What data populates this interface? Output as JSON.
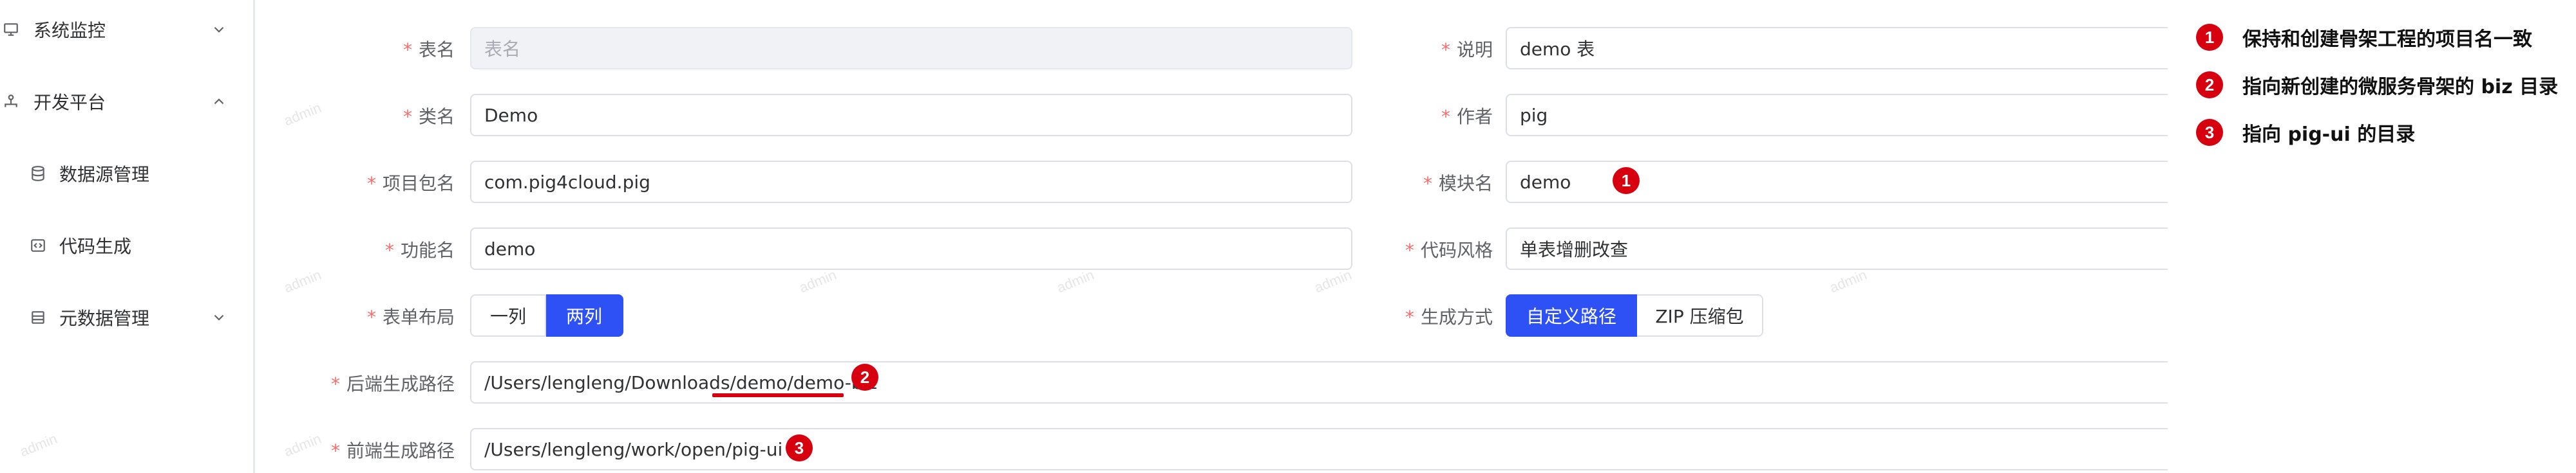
{
  "sidebar": {
    "items": [
      {
        "label": "系统监控",
        "icon": "monitor-icon",
        "chevron": "chevron-down-icon"
      },
      {
        "label": "开发平台",
        "icon": "platform-icon",
        "chevron": "chevron-up-icon"
      },
      {
        "label": "数据源管理",
        "icon": "database-icon"
      },
      {
        "label": "代码生成",
        "icon": "code-icon"
      },
      {
        "label": "元数据管理",
        "icon": "table-icon",
        "chevron": "chevron-down-icon"
      }
    ]
  },
  "watermark": "admin",
  "form": {
    "table_name": {
      "label": "表名",
      "placeholder": "表名"
    },
    "description": {
      "label": "说明",
      "value": "demo 表"
    },
    "class_name": {
      "label": "类名",
      "value": "Demo"
    },
    "author": {
      "label": "作者",
      "value": "pig"
    },
    "package_name": {
      "label": "项目包名",
      "value": "com.pig4cloud.pig"
    },
    "module_name": {
      "label": "模块名",
      "value": "demo"
    },
    "function_name": {
      "label": "功能名",
      "value": "demo"
    },
    "code_style": {
      "label": "代码风格",
      "value": "单表增删改查"
    },
    "form_layout": {
      "label": "表单布局",
      "options": [
        "一列",
        "两列"
      ],
      "selected": "两列"
    },
    "gen_type": {
      "label": "生成方式",
      "options": [
        "自定义路径",
        "ZIP 压缩包"
      ],
      "selected": "自定义路径"
    },
    "backend_path": {
      "label": "后端生成路径",
      "value": "/Users/lengleng/Downloads/demo/demo-biz"
    },
    "frontend_path": {
      "label": "前端生成路径",
      "value": "/Users/lengleng/work/open/pig-ui"
    }
  },
  "annotations": [
    {
      "number": "1",
      "text": "保持和创建骨架工程的项目名一致"
    },
    {
      "number": "2",
      "text": "指向新创建的微服务骨架的 biz 目录"
    },
    {
      "number": "3",
      "text": "指向 pig-ui 的目录"
    }
  ],
  "colors": {
    "accent": "#2d51f5",
    "required": "#f56c6c",
    "badge": "#d7000f"
  }
}
